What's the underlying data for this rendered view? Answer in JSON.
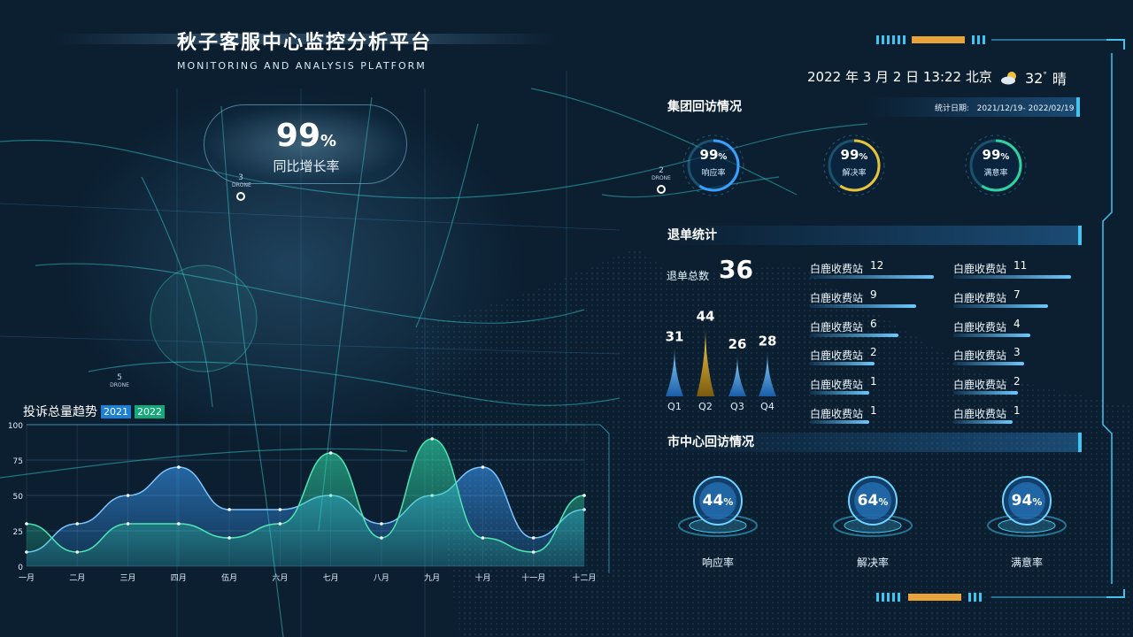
{
  "title": {
    "main": "秋子客服中心监控分析平台",
    "sub": "MONITORING AND ANALYSIS PLATFORM"
  },
  "growth": {
    "value": "99",
    "unit": "%",
    "label": "同比增长率"
  },
  "datetime": "2022 年 3 月  2 日  13:22   北京",
  "weather": {
    "temp": "32",
    "degree": "°",
    "desc": "晴",
    "icon": "partly-cloudy-icon"
  },
  "colors": {
    "accent": "#43c4f0",
    "yellow": "#e8c33a",
    "green": "#2ed3a2",
    "blue": "#3aa0ff",
    "series2021": "#1e7fd6",
    "series2022": "#1ec98c"
  },
  "group": {
    "title": "集团回访情况",
    "range_label": "统计日期:",
    "range_value": "2021/12/19- 2022/02/19",
    "rings": [
      {
        "value": "99",
        "unit": "%",
        "label": "响应率",
        "fraction": 0.99,
        "color": "#3aa0ff"
      },
      {
        "value": "99",
        "unit": "%",
        "label": "解决率",
        "fraction": 0.99,
        "color": "#e8c33a"
      },
      {
        "value": "99",
        "unit": "%",
        "label": "满意率",
        "fraction": 0.99,
        "color": "#2ed3a2"
      }
    ]
  },
  "refund": {
    "title": "退单统计",
    "total_label": "退单总数",
    "total_value": "36",
    "quarters": [
      {
        "label": "Q1",
        "value": 31
      },
      {
        "label": "Q2",
        "value": 44
      },
      {
        "label": "Q3",
        "value": 26
      },
      {
        "label": "Q4",
        "value": 28
      }
    ],
    "left_rows": [
      {
        "name": "白鹿收费站",
        "value": "12"
      },
      {
        "name": "白鹿收费站",
        "value": "9"
      },
      {
        "name": "白鹿收费站",
        "value": "6"
      },
      {
        "name": "白鹿收费站",
        "value": "2"
      },
      {
        "name": "白鹿收费站",
        "value": "1"
      },
      {
        "name": "白鹿收费站",
        "value": "1"
      }
    ],
    "right_rows": [
      {
        "name": "白鹿收费站",
        "value": "11"
      },
      {
        "name": "白鹿收费站",
        "value": "7"
      },
      {
        "name": "白鹿收费站",
        "value": "4"
      },
      {
        "name": "白鹿收费站",
        "value": "3"
      },
      {
        "name": "白鹿收费站",
        "value": "2"
      },
      {
        "name": "白鹿收费站",
        "value": "1"
      }
    ]
  },
  "city": {
    "title": "市中心回访情况",
    "items": [
      {
        "value": "44",
        "unit": "%",
        "label": "响应率"
      },
      {
        "value": "64",
        "unit": "%",
        "label": "解决率"
      },
      {
        "value": "94",
        "unit": "%",
        "label": "满意率"
      }
    ]
  },
  "map_markers": [
    {
      "label": "3",
      "sub": "DRONE"
    },
    {
      "label": "2",
      "sub": "DRONE"
    },
    {
      "label": "5",
      "sub": "DRONE"
    }
  ],
  "chart_data": {
    "type": "area",
    "title": "投诉总量趋势",
    "categories": [
      "一月",
      "二月",
      "三月",
      "四月",
      "伍月",
      "六月",
      "七月",
      "八月",
      "九月",
      "十月",
      "十一月",
      "十二月"
    ],
    "ylim": [
      0,
      100
    ],
    "yticks": [
      "0",
      "25",
      "50",
      "75",
      "100"
    ],
    "series": [
      {
        "name": "2021",
        "color": "#3aa0ff",
        "values": [
          10,
          30,
          50,
          70,
          40,
          40,
          50,
          30,
          50,
          70,
          20,
          40
        ]
      },
      {
        "name": "2022",
        "color": "#2ed3a2",
        "values": [
          30,
          10,
          30,
          30,
          20,
          30,
          80,
          20,
          90,
          20,
          10,
          50
        ]
      }
    ]
  }
}
